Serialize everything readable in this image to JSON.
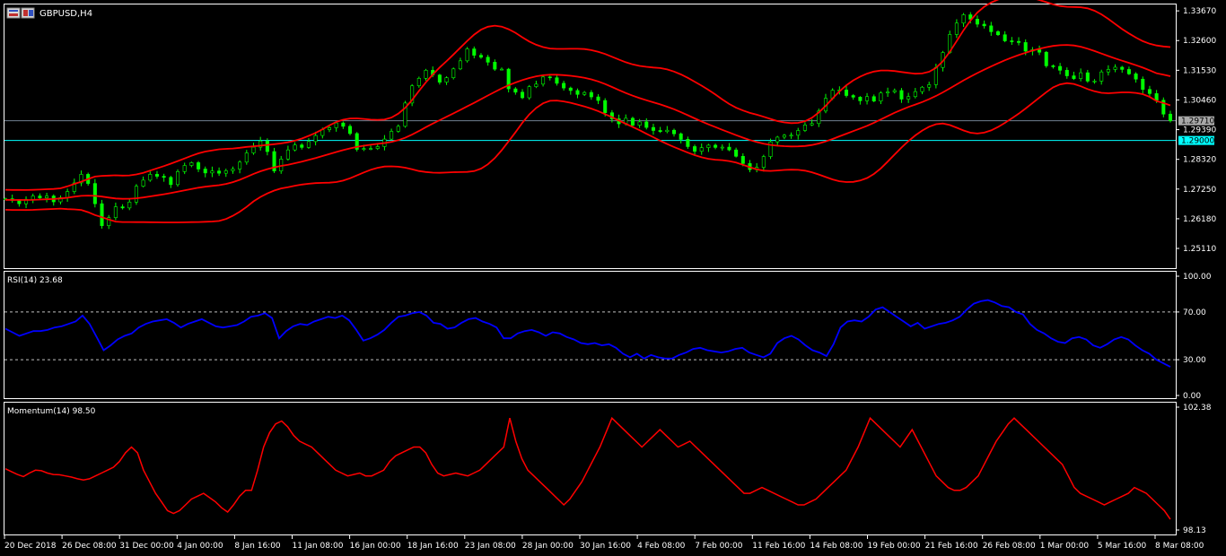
{
  "window": {
    "symbol_label": "GBPUSD,H4"
  },
  "colors": {
    "background": "#000000",
    "grid_axis": "#ffffff",
    "candle": "#00ff00",
    "bollinger": "#ff0000",
    "rsi": "#0000ff",
    "momentum": "#ff0000",
    "hline_grey": "#708090",
    "hline_cyan": "#00ffff",
    "tag_grey_bg": "#a9a9a9",
    "tag_cyan_bg": "#00ffff"
  },
  "chart_data": [
    {
      "type": "candlestick",
      "name": "GBPUSD,H4",
      "indicators": [
        "Bollinger Bands"
      ],
      "ylim": [
        1.244,
        1.339
      ],
      "y_ticks": [
        "1.33670",
        "1.32600",
        "1.31530",
        "1.30460",
        "1.29390",
        "1.28320",
        "1.27250",
        "1.26180",
        "1.25110"
      ],
      "y_tick_values": [
        1.3367,
        1.326,
        1.3153,
        1.3046,
        1.2939,
        1.2832,
        1.2725,
        1.2618,
        1.2511
      ],
      "horizontal_lines": [
        {
          "value": 1.2971,
          "label": "1.29710",
          "color": "grey"
        },
        {
          "value": 1.29,
          "label": "1.29000",
          "color": "cyan"
        }
      ],
      "close_path": [
        1.269,
        1.2684,
        1.2672,
        1.2688,
        1.27,
        1.2693,
        1.27,
        1.2679,
        1.2694,
        1.2716,
        1.2747,
        1.2778,
        1.2745,
        1.2672,
        1.2593,
        1.2622,
        1.2661,
        1.2657,
        1.2678,
        1.2735,
        1.2757,
        1.2778,
        1.2771,
        1.2767,
        1.2741,
        1.2788,
        1.281,
        1.282,
        1.2797,
        1.2783,
        1.279,
        1.2782,
        1.2791,
        1.2797,
        1.2822,
        1.2855,
        1.2876,
        1.2898,
        1.286,
        1.279,
        1.2833,
        1.2866,
        1.2884,
        1.2875,
        1.2896,
        1.2918,
        1.2939,
        1.2946,
        1.2963,
        1.2951,
        1.2925,
        1.2868,
        1.2871,
        1.2871,
        1.2878,
        1.2905,
        1.2933,
        1.2951,
        1.3035,
        1.3097,
        1.3124,
        1.3153,
        1.3136,
        1.311,
        1.3126,
        1.3158,
        1.3187,
        1.323,
        1.3207,
        1.32,
        1.3182,
        1.3157,
        1.3157,
        1.3086,
        1.3074,
        1.3054,
        1.3094,
        1.3103,
        1.3129,
        1.3126,
        1.3106,
        1.3089,
        1.308,
        1.3066,
        1.3073,
        1.3057,
        1.3044,
        1.3,
        1.2978,
        1.296,
        1.298,
        1.2955,
        1.2967,
        1.2947,
        1.2936,
        1.2932,
        1.2937,
        1.2924,
        1.2904,
        1.2878,
        1.2861,
        1.2874,
        1.2883,
        1.2875,
        1.2876,
        1.2866,
        1.2843,
        1.2817,
        1.2795,
        1.2803,
        1.2842,
        1.2895,
        1.2912,
        1.2919,
        1.2919,
        1.2936,
        1.2956,
        1.2961,
        1.3006,
        1.3052,
        1.3081,
        1.3082,
        1.3062,
        1.3056,
        1.3043,
        1.3058,
        1.3042,
        1.3071,
        1.3075,
        1.308,
        1.3049,
        1.3058,
        1.3076,
        1.3092,
        1.3101,
        1.3163,
        1.3217,
        1.3282,
        1.3323,
        1.3353,
        1.3337,
        1.3319,
        1.3313,
        1.3292,
        1.3281,
        1.3259,
        1.3257,
        1.3253,
        1.3222,
        1.3227,
        1.3218,
        1.3169,
        1.3167,
        1.3153,
        1.3133,
        1.3123,
        1.3144,
        1.3114,
        1.3114,
        1.3147,
        1.3156,
        1.3164,
        1.3156,
        1.314,
        1.3121,
        1.3084,
        1.3069,
        1.3045,
        1.2995,
        1.2971
      ]
    },
    {
      "type": "line",
      "name": "RSI(14)",
      "header": "RSI(14) 23.68",
      "ylim": [
        0,
        100
      ],
      "y_ticks": [
        "100.00",
        "70.00",
        "30.00",
        "0.00"
      ],
      "y_tick_values": [
        100,
        70,
        30,
        0
      ],
      "levels": [
        70,
        30
      ],
      "current": 23.68,
      "values": [
        56,
        53,
        50,
        52,
        54,
        54,
        55,
        57,
        58,
        60,
        62,
        67,
        60,
        49,
        38,
        42,
        47,
        50,
        52,
        57,
        60,
        62,
        63,
        64,
        61,
        57,
        60,
        62,
        64,
        61,
        58,
        57,
        58,
        59,
        62,
        66,
        67,
        69,
        65,
        48,
        54,
        58,
        60,
        59,
        62,
        64,
        66,
        65,
        67,
        63,
        55,
        46,
        48,
        51,
        55,
        61,
        66,
        67,
        69,
        70,
        67,
        61,
        60,
        56,
        57,
        61,
        64,
        65,
        62,
        60,
        57,
        48,
        48,
        52,
        54,
        55,
        53,
        50,
        53,
        52,
        49,
        47,
        44,
        43,
        44,
        42,
        43,
        40,
        35,
        32,
        35,
        31,
        34,
        32,
        31,
        31,
        34,
        36,
        39,
        40,
        38,
        37,
        36,
        37,
        39,
        40,
        36,
        34,
        32,
        35,
        44,
        48,
        50,
        47,
        42,
        38,
        36,
        33,
        43,
        57,
        62,
        63,
        62,
        66,
        72,
        74,
        70,
        66,
        62,
        58,
        61,
        56,
        58,
        60,
        61,
        63,
        66,
        72,
        77,
        79,
        80,
        78,
        75,
        74,
        70,
        68,
        60,
        55,
        52,
        48,
        45,
        44,
        48,
        49,
        47,
        42,
        40,
        43,
        47,
        49,
        47,
        42,
        38,
        35,
        30,
        27,
        24
      ]
    },
    {
      "type": "line",
      "name": "Momentum(14)",
      "header": "Momentum(14) 98.50",
      "ylim": [
        98.13,
        102.38
      ],
      "y_ticks": [
        "102.38",
        "98.13"
      ],
      "y_tick_values": [
        102.38,
        98.13
      ],
      "current": 98.5,
      "values": [
        100.25,
        100.15,
        100.05,
        99.98,
        100.1,
        100.2,
        100.18,
        100.1,
        100.05,
        100.04,
        100.0,
        99.96,
        99.9,
        99.86,
        99.9,
        100.0,
        100.1,
        100.2,
        100.3,
        100.5,
        100.8,
        101.0,
        100.8,
        100.2,
        99.8,
        99.4,
        99.1,
        98.8,
        98.7,
        98.8,
        99.0,
        99.2,
        99.3,
        99.4,
        99.25,
        99.1,
        98.9,
        98.75,
        99.0,
        99.3,
        99.5,
        99.5,
        100.2,
        101.0,
        101.5,
        101.8,
        101.9,
        101.7,
        101.4,
        101.2,
        101.1,
        101.0,
        100.8,
        100.6,
        100.4,
        100.2,
        100.1,
        100.0,
        100.05,
        100.1,
        100.0,
        100.0,
        100.1,
        100.2,
        100.5,
        100.7,
        100.8,
        100.9,
        101.0,
        101.0,
        100.8,
        100.4,
        100.1,
        100.0,
        100.05,
        100.1,
        100.05,
        100.0,
        100.1,
        100.2,
        100.4,
        100.6,
        100.8,
        101.0,
        102.0,
        101.2,
        100.6,
        100.2,
        100.0,
        99.8,
        99.6,
        99.4,
        99.2,
        99.0,
        99.2,
        99.5,
        99.8,
        100.2,
        100.6,
        101.0,
        101.5,
        102.0,
        101.8,
        101.6,
        101.4,
        101.2,
        101.0,
        101.2,
        101.4,
        101.6,
        101.4,
        101.2,
        101.0,
        101.1,
        101.2,
        101.0,
        100.8,
        100.6,
        100.4,
        100.2,
        100.0,
        99.8,
        99.6,
        99.4,
        99.4,
        99.5,
        99.6,
        99.5,
        99.4,
        99.3,
        99.2,
        99.1,
        99.0,
        99.0,
        99.1,
        99.2,
        99.4,
        99.6,
        99.8,
        100.0,
        100.2,
        100.6,
        101.0,
        101.5,
        102.0,
        101.8,
        101.6,
        101.4,
        101.2,
        101.0,
        101.3,
        101.6,
        101.2,
        100.8,
        100.4,
        100.0,
        99.8,
        99.6,
        99.5,
        99.5,
        99.6,
        99.8,
        100.0,
        100.4,
        100.8,
        101.2,
        101.5,
        101.8,
        102.0,
        101.8,
        101.6,
        101.4,
        101.2,
        101.0,
        100.8,
        100.6,
        100.4,
        100.0,
        99.6,
        99.4,
        99.3,
        99.2,
        99.1,
        99.0,
        99.1,
        99.2,
        99.3,
        99.4,
        99.6,
        99.5,
        99.4,
        99.2,
        99.0,
        98.8,
        98.5
      ]
    }
  ],
  "x_axis": {
    "labels": [
      "20 Dec 2018",
      "26 Dec 08:00",
      "31 Dec 00:00",
      "4 Jan 00:00",
      "8 Jan 16:00",
      "11 Jan 08:00",
      "16 Jan 00:00",
      "18 Jan 16:00",
      "23 Jan 08:00",
      "28 Jan 00:00",
      "30 Jan 16:00",
      "4 Feb 08:00",
      "7 Feb 00:00",
      "11 Feb 16:00",
      "14 Feb 08:00",
      "19 Feb 00:00",
      "21 Feb 16:00",
      "26 Feb 08:00",
      "1 Mar 00:00",
      "5 Mar 16:00",
      "8 Mar 08:00"
    ]
  }
}
